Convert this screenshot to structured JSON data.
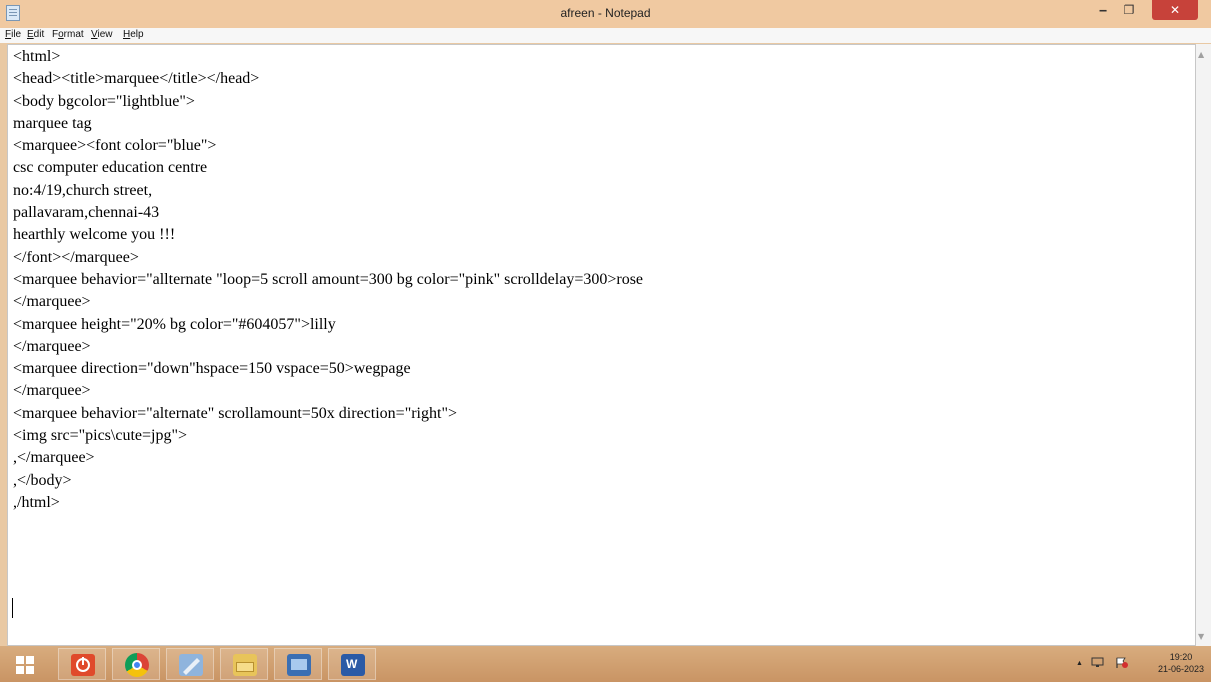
{
  "window": {
    "title": "afreen - Notepad",
    "minimize_glyph": "‒",
    "maximize_glyph": "❐",
    "close_glyph": "✕"
  },
  "menu": {
    "items": [
      {
        "label": "File",
        "underline": "F",
        "rest": "ile"
      },
      {
        "label": "Edit",
        "underline": "E",
        "rest": "dit"
      },
      {
        "label": "Format",
        "pre": "F",
        "underline": "o",
        "rest": "rmat"
      },
      {
        "label": "View",
        "underline": "V",
        "rest": "iew"
      },
      {
        "label": "Help",
        "underline": "H",
        "rest": "elp"
      }
    ]
  },
  "editor": {
    "content": "<html>\n<head><title>marquee</title></head>\n<body bgcolor=\"lightblue\">\nmarquee tag\n<marquee><font color=\"blue\">\ncsc computer education centre\nno:4/19,church street,\npallavaram,chennai-43\nhearthly welcome you !!!\n</font></marquee>\n<marquee behavior=\"allternate \"loop=5 scroll amount=300 bg color=\"pink\" scrolldelay=300>rose\n</marquee>\n<marquee height=\"20% bg color=\"#604057\">lilly\n</marquee>\n<marquee direction=\"down\"hspace=150 vspace=50>wegpage\n</marquee>\n<marquee behavior=\"alternate\" scrollamount=50x direction=\"right\">\n<img src=\"pics\\cute=jpg\">\n,</marquee>\n,</body>\n,/html>"
  },
  "scrollbar": {
    "up_glyph": "▲",
    "down_glyph": "▼"
  },
  "taskbar": {
    "apps": [
      {
        "name": "power-app-icon",
        "color": "#e04a2b"
      },
      {
        "name": "chrome-icon",
        "color": "#3b8ee0"
      },
      {
        "name": "notepad-icon",
        "color": "#6a93c9"
      },
      {
        "name": "file-explorer-icon",
        "color": "#e8c45a"
      },
      {
        "name": "media-app-icon",
        "color": "#3b6fb3"
      },
      {
        "name": "word-icon",
        "color": "#2b5aa6"
      }
    ],
    "tray": {
      "up_arrow": "▲"
    },
    "clock": {
      "time": "19:20",
      "date": "21-06-2023"
    }
  },
  "colors": {
    "titlebar": "#f0c9a1",
    "close_button": "#c7423a",
    "taskbar": "#d0a070"
  }
}
